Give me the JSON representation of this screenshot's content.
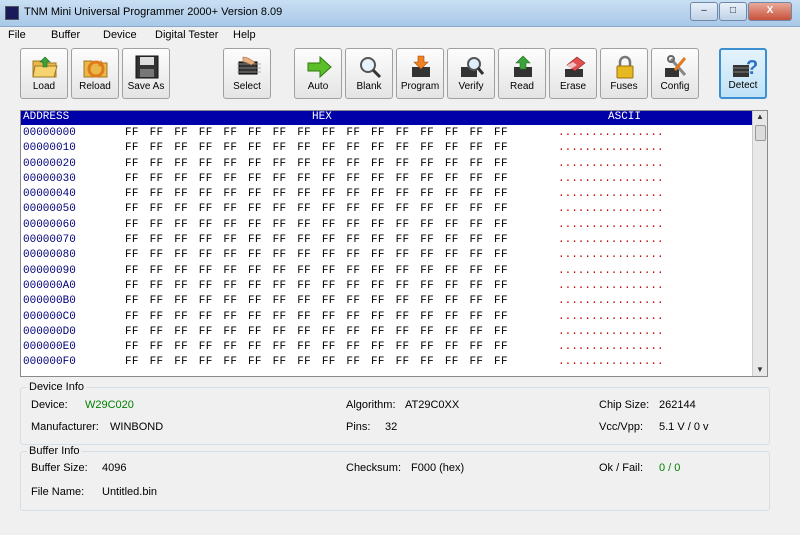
{
  "window": {
    "title": "TNM Mini Universal Programmer 2000+   Version 8.09",
    "min": "–",
    "max": "□",
    "close": "X"
  },
  "menu": [
    "File",
    "Buffer",
    "Device",
    "Digital Tester",
    "Help"
  ],
  "toolbar": [
    {
      "label": "Load",
      "icon": "folder-icon"
    },
    {
      "label": "Reload",
      "icon": "reload-icon"
    },
    {
      "label": "Save As",
      "icon": "floppy-icon"
    },
    {
      "label": "Select",
      "icon": "chip-hand-icon"
    },
    {
      "label": "Auto",
      "icon": "arrow-right-icon"
    },
    {
      "label": "Blank",
      "icon": "magnifier-icon"
    },
    {
      "label": "Program",
      "icon": "chip-down-icon"
    },
    {
      "label": "Verify",
      "icon": "chip-magnifier-icon"
    },
    {
      "label": "Read",
      "icon": "chip-up-icon"
    },
    {
      "label": "Erase",
      "icon": "eraser-icon"
    },
    {
      "label": "Fuses",
      "icon": "lock-icon"
    },
    {
      "label": "Config",
      "icon": "tools-icon"
    },
    {
      "label": "Detect",
      "icon": "chip-question-icon"
    }
  ],
  "hexview": {
    "headers": {
      "address": "ADDRESS",
      "hex": "HEX",
      "ascii": "ASCII"
    },
    "rows": [
      {
        "addr": "00000000",
        "hex": "FF FF FF FF FF FF FF FF FF FF FF FF FF FF FF FF",
        "ascii": "................"
      },
      {
        "addr": "00000010",
        "hex": "FF FF FF FF FF FF FF FF FF FF FF FF FF FF FF FF",
        "ascii": "................"
      },
      {
        "addr": "00000020",
        "hex": "FF FF FF FF FF FF FF FF FF FF FF FF FF FF FF FF",
        "ascii": "................"
      },
      {
        "addr": "00000030",
        "hex": "FF FF FF FF FF FF FF FF FF FF FF FF FF FF FF FF",
        "ascii": "................"
      },
      {
        "addr": "00000040",
        "hex": "FF FF FF FF FF FF FF FF FF FF FF FF FF FF FF FF",
        "ascii": "................"
      },
      {
        "addr": "00000050",
        "hex": "FF FF FF FF FF FF FF FF FF FF FF FF FF FF FF FF",
        "ascii": "................"
      },
      {
        "addr": "00000060",
        "hex": "FF FF FF FF FF FF FF FF FF FF FF FF FF FF FF FF",
        "ascii": "................"
      },
      {
        "addr": "00000070",
        "hex": "FF FF FF FF FF FF FF FF FF FF FF FF FF FF FF FF",
        "ascii": "................"
      },
      {
        "addr": "00000080",
        "hex": "FF FF FF FF FF FF FF FF FF FF FF FF FF FF FF FF",
        "ascii": "................"
      },
      {
        "addr": "00000090",
        "hex": "FF FF FF FF FF FF FF FF FF FF FF FF FF FF FF FF",
        "ascii": "................"
      },
      {
        "addr": "000000A0",
        "hex": "FF FF FF FF FF FF FF FF FF FF FF FF FF FF FF FF",
        "ascii": "................"
      },
      {
        "addr": "000000B0",
        "hex": "FF FF FF FF FF FF FF FF FF FF FF FF FF FF FF FF",
        "ascii": "................"
      },
      {
        "addr": "000000C0",
        "hex": "FF FF FF FF FF FF FF FF FF FF FF FF FF FF FF FF",
        "ascii": "................"
      },
      {
        "addr": "000000D0",
        "hex": "FF FF FF FF FF FF FF FF FF FF FF FF FF FF FF FF",
        "ascii": "................"
      },
      {
        "addr": "000000E0",
        "hex": "FF FF FF FF FF FF FF FF FF FF FF FF FF FF FF FF",
        "ascii": "................"
      },
      {
        "addr": "000000F0",
        "hex": "FF FF FF FF FF FF FF FF FF FF FF FF FF FF FF FF",
        "ascii": "................"
      }
    ]
  },
  "device_info": {
    "title": "Device Info",
    "device_label": "Device:",
    "device_value": "W29C020",
    "manufacturer_label": "Manufacturer:",
    "manufacturer_value": "WINBOND",
    "algorithm_label": "Algorithm:",
    "algorithm_value": "AT29C0XX",
    "pins_label": "Pins:",
    "pins_value": "32",
    "chipsize_label": "Chip Size:",
    "chipsize_value": "262144",
    "vcc_label": "Vcc/Vpp:",
    "vcc_value": "5.1 V / 0 v"
  },
  "buffer_info": {
    "title": "Buffer Info",
    "size_label": "Buffer Size:",
    "size_value": "4096",
    "filename_label": "File Name:",
    "filename_value": "Untitled.bin",
    "checksum_label": "Checksum:",
    "checksum_value": "F000 (hex)",
    "okfail_label": "Ok / Fail:",
    "okfail_value": "0 / 0"
  },
  "colors": {
    "header_bg": "#0000a8",
    "address": "#00007a",
    "ascii": "#c00000",
    "value_green": "#007f00",
    "active_border": "#3c8fd0"
  }
}
